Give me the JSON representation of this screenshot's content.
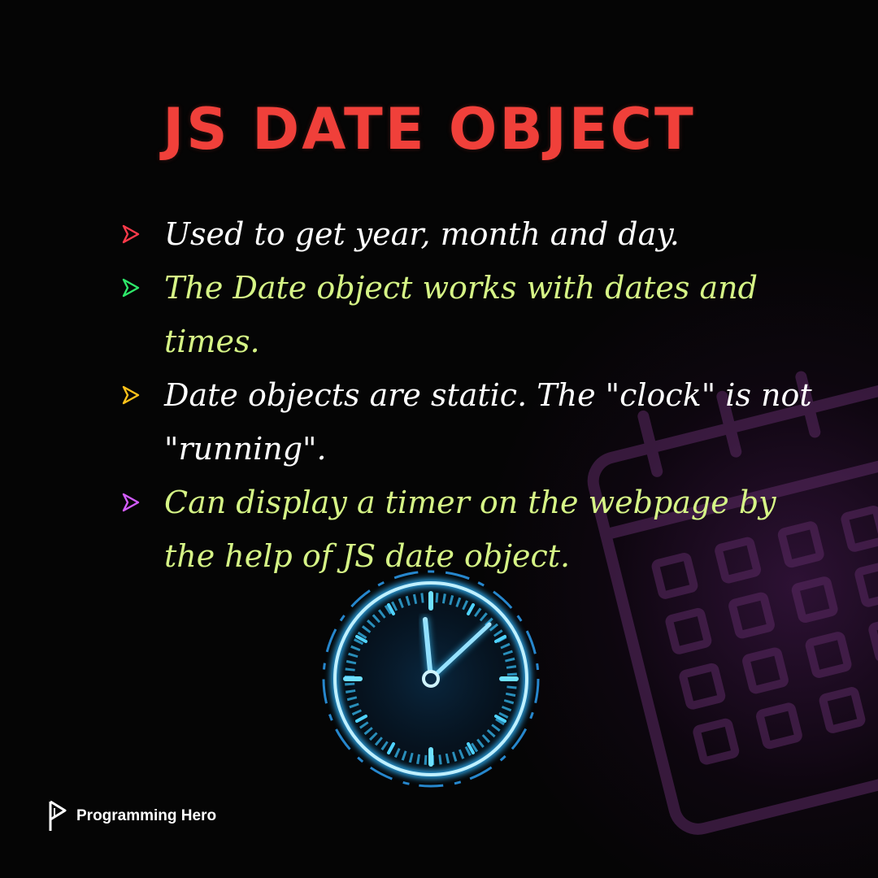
{
  "title": "JS DATE OBJECT",
  "bullets": [
    {
      "text": "Used to get year, month and day.",
      "color": "#ffffff",
      "chevron_color": "#ff3a4a"
    },
    {
      "text": "The Date object works with dates and times.",
      "color": "#d6f586",
      "chevron_color": "#2ee86a"
    },
    {
      "text": "Date objects are static. The \"clock\" is not \"running\".",
      "color": "#ffffff",
      "chevron_color": "#ffc21a"
    },
    {
      "text": "Can display a timer on the webpage by the help of JS date object.",
      "color": "#d6f586",
      "chevron_color": "#d35cff"
    }
  ],
  "brand": {
    "name": "Programming Hero",
    "icon": "play-icon"
  },
  "colors": {
    "title": "#f0403a",
    "background": "#050505",
    "clock_glow": "#2fb6ff",
    "calendar_glow": "#7a2a8a"
  },
  "decorations": [
    "clock-icon",
    "calendar-icon"
  ]
}
